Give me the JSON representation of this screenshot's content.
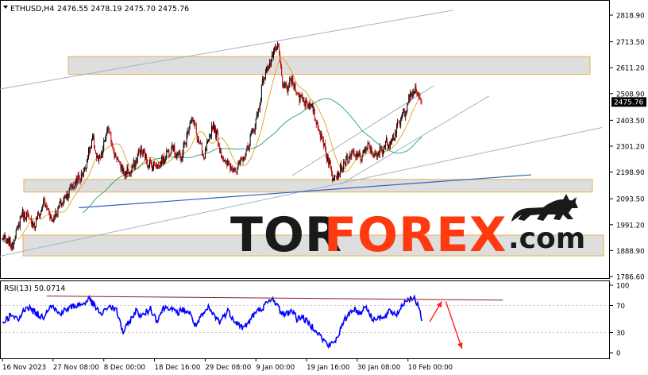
{
  "header": {
    "symbol": "ETHUSD,H4",
    "ohlc": "2476.55 2478.19 2475.70 2475.76"
  },
  "colors": {
    "bull": "#000000",
    "bear": "#c00000",
    "ma_fast": "#e0a020",
    "ma_slow": "#20a070",
    "trend_gray": "#9fb4c8",
    "trend_blue": "#3060c0",
    "zone_fill": "#d8d8d8",
    "zone_border": "#e8b050",
    "rsi_line": "#0000ff",
    "rsi_resist": "#8b2020",
    "arrow": "#ff2020",
    "price_tag_bg": "#000000",
    "brand_dark": "#1a1a1a",
    "brand_accent": "#ff3a10"
  },
  "watermark": {
    "part1": "TOR",
    "part2": "FOREX",
    "part3": ".com",
    "logo": "bull-icon"
  },
  "chart_data": [
    {
      "type": "candlestick",
      "title": "ETHUSD,H4",
      "price_axis_ticks": [
        "2818.90",
        "2713.50",
        "2611.20",
        "2508.90",
        "2403.50",
        "2301.20",
        "2198.90",
        "2093.50",
        "1991.20",
        "1888.90",
        "1786.60"
      ],
      "price_axis_values": [
        2818.9,
        2713.5,
        2611.2,
        2508.9,
        2403.5,
        2301.2,
        2198.9,
        2093.5,
        1991.2,
        1888.9,
        1786.6
      ],
      "ylim": [
        1786.6,
        2818.9
      ],
      "current_price": "2475.76",
      "time_axis_labels": [
        "16 Nov 2023",
        "27 Nov 08:00",
        "8 Dec 00:00",
        "18 Dec 16:00",
        "29 Dec 08:00",
        "9 Jan 00:00",
        "19 Jan 16:00",
        "30 Jan 08:00",
        "10 Feb 00:00"
      ],
      "time_axis_index": [
        0,
        63,
        126,
        189,
        252,
        315,
        378,
        441,
        504
      ],
      "bar_count": 522,
      "close_keyframes": [
        [
          0,
          1935
        ],
        [
          12,
          1910
        ],
        [
          25,
          2040
        ],
        [
          40,
          1990
        ],
        [
          52,
          2080
        ],
        [
          62,
          2010
        ],
        [
          74,
          2080
        ],
        [
          86,
          2140
        ],
        [
          100,
          2190
        ],
        [
          112,
          2330
        ],
        [
          120,
          2230
        ],
        [
          132,
          2380
        ],
        [
          138,
          2280
        ],
        [
          150,
          2200
        ],
        [
          160,
          2200
        ],
        [
          172,
          2290
        ],
        [
          182,
          2230
        ],
        [
          196,
          2230
        ],
        [
          210,
          2300
        ],
        [
          222,
          2250
        ],
        [
          235,
          2420
        ],
        [
          250,
          2250
        ],
        [
          262,
          2390
        ],
        [
          275,
          2240
        ],
        [
          290,
          2210
        ],
        [
          300,
          2250
        ],
        [
          316,
          2410
        ],
        [
          325,
          2580
        ],
        [
          334,
          2640
        ],
        [
          342,
          2700
        ],
        [
          350,
          2520
        ],
        [
          360,
          2560
        ],
        [
          368,
          2500
        ],
        [
          378,
          2475
        ],
        [
          386,
          2440
        ],
        [
          394,
          2360
        ],
        [
          402,
          2280
        ],
        [
          410,
          2185
        ],
        [
          418,
          2200
        ],
        [
          426,
          2240
        ],
        [
          436,
          2270
        ],
        [
          446,
          2260
        ],
        [
          455,
          2300
        ],
        [
          464,
          2260
        ],
        [
          474,
          2300
        ],
        [
          484,
          2330
        ],
        [
          492,
          2380
        ],
        [
          500,
          2440
        ],
        [
          507,
          2500
        ],
        [
          513,
          2520
        ],
        [
          521,
          2476
        ]
      ],
      "indicators": [
        {
          "name": "MA fast",
          "color": "#e0a020",
          "period": 20
        },
        {
          "name": "MA slow",
          "color": "#20a070",
          "period": 100
        }
      ],
      "support_resistance_zones": [
        {
          "top": 2655,
          "bottom": 2585
        },
        {
          "top": 2170,
          "bottom": 2120
        },
        {
          "top": 1950,
          "bottom": 1868
        }
      ],
      "trendlines": [
        {
          "color": "#9fb4c8",
          "points": [
            [
              -6,
              2525
            ],
            [
              560,
              2838
            ]
          ]
        },
        {
          "color": "#9fb4c8",
          "points": [
            [
              -6,
              1865
            ],
            [
              745,
              2375
            ]
          ]
        },
        {
          "color": "#9fb4c8",
          "points": [
            [
              420,
              2150
            ],
            [
              605,
              2500
            ]
          ]
        },
        {
          "color": "#9fb4c8",
          "points": [
            [
              360,
              2185
            ],
            [
              536,
              2540
            ]
          ]
        },
        {
          "color": "#3060c0",
          "points": [
            [
              95,
              2058
            ],
            [
              657,
              2188
            ]
          ]
        }
      ],
      "grid": false
    },
    {
      "type": "line",
      "title": "RSI(13) 50.0714",
      "series": [
        {
          "name": "RSI(13)",
          "color": "#0000ff"
        }
      ],
      "ylim": [
        0,
        100
      ],
      "level_labels": [
        "100",
        "70",
        "30",
        "0"
      ],
      "level_values": [
        100,
        70,
        30,
        0
      ],
      "rsi_keyframes": [
        [
          0,
          45
        ],
        [
          10,
          55
        ],
        [
          20,
          48
        ],
        [
          30,
          70
        ],
        [
          40,
          60
        ],
        [
          50,
          52
        ],
        [
          60,
          72
        ],
        [
          70,
          58
        ],
        [
          80,
          64
        ],
        [
          90,
          70
        ],
        [
          100,
          72
        ],
        [
          108,
          80
        ],
        [
          116,
          66
        ],
        [
          124,
          56
        ],
        [
          132,
          70
        ],
        [
          142,
          62
        ],
        [
          150,
          30
        ],
        [
          158,
          46
        ],
        [
          166,
          62
        ],
        [
          174,
          54
        ],
        [
          184,
          66
        ],
        [
          192,
          48
        ],
        [
          200,
          66
        ],
        [
          208,
          68
        ],
        [
          216,
          58
        ],
        [
          224,
          64
        ],
        [
          232,
          60
        ],
        [
          240,
          40
        ],
        [
          248,
          54
        ],
        [
          256,
          66
        ],
        [
          264,
          54
        ],
        [
          270,
          46
        ],
        [
          280,
          62
        ],
        [
          290,
          46
        ],
        [
          300,
          36
        ],
        [
          312,
          56
        ],
        [
          322,
          66
        ],
        [
          330,
          74
        ],
        [
          337,
          80
        ],
        [
          345,
          62
        ],
        [
          352,
          56
        ],
        [
          360,
          64
        ],
        [
          366,
          50
        ],
        [
          372,
          54
        ],
        [
          380,
          44
        ],
        [
          390,
          34
        ],
        [
          398,
          20
        ],
        [
          406,
          10
        ],
        [
          414,
          18
        ],
        [
          420,
          34
        ],
        [
          428,
          54
        ],
        [
          436,
          66
        ],
        [
          444,
          58
        ],
        [
          452,
          70
        ],
        [
          460,
          48
        ],
        [
          466,
          54
        ],
        [
          474,
          50
        ],
        [
          482,
          62
        ],
        [
          490,
          56
        ],
        [
          496,
          70
        ],
        [
          504,
          80
        ],
        [
          510,
          82
        ],
        [
          515,
          74
        ],
        [
          521,
          50
        ]
      ],
      "resistance_line": [
        [
          55,
          84
        ],
        [
          622,
          78
        ]
      ],
      "forecast_arrows": [
        {
          "from": [
            531,
            46
          ],
          "to": [
            546,
            76
          ]
        },
        {
          "from": [
            551,
            76
          ],
          "to": [
            571,
            6
          ]
        }
      ]
    }
  ]
}
